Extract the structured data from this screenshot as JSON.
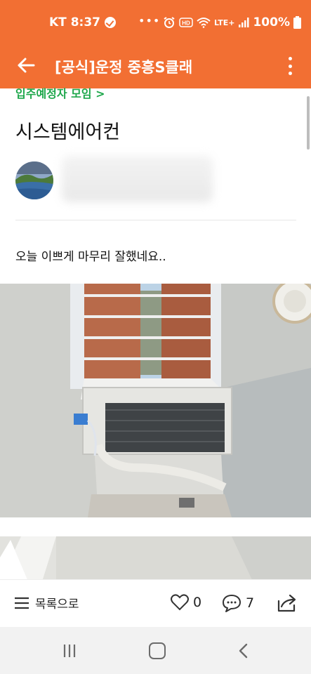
{
  "status_bar": {
    "carrier_time": "KT 8:37",
    "overflow": "•••",
    "network": "LTE+",
    "battery": "100%",
    "icons": [
      "check-circle-icon",
      "alarm-icon",
      "hd-icon",
      "wifi-icon",
      "signal-icon"
    ]
  },
  "app_bar": {
    "title": "[공식]운정 중흥S클래",
    "back_icon": "arrow-left-icon",
    "menu_icon": "more-vertical-icon",
    "color": "#f26f33"
  },
  "post": {
    "category": "입주예정자 모임 >",
    "title": "시스템에어컨",
    "body": "오늘 이쁘게 마무리 잘했네요.."
  },
  "action_bar": {
    "list_label": "목록으로",
    "like_count": "0",
    "comment_count": "7",
    "icons": [
      "menu-lines-icon",
      "heart-icon",
      "comment-icon",
      "share-icon"
    ]
  },
  "nav_bar": {
    "icons": [
      "recent-apps-icon",
      "home-icon",
      "back-icon"
    ]
  }
}
